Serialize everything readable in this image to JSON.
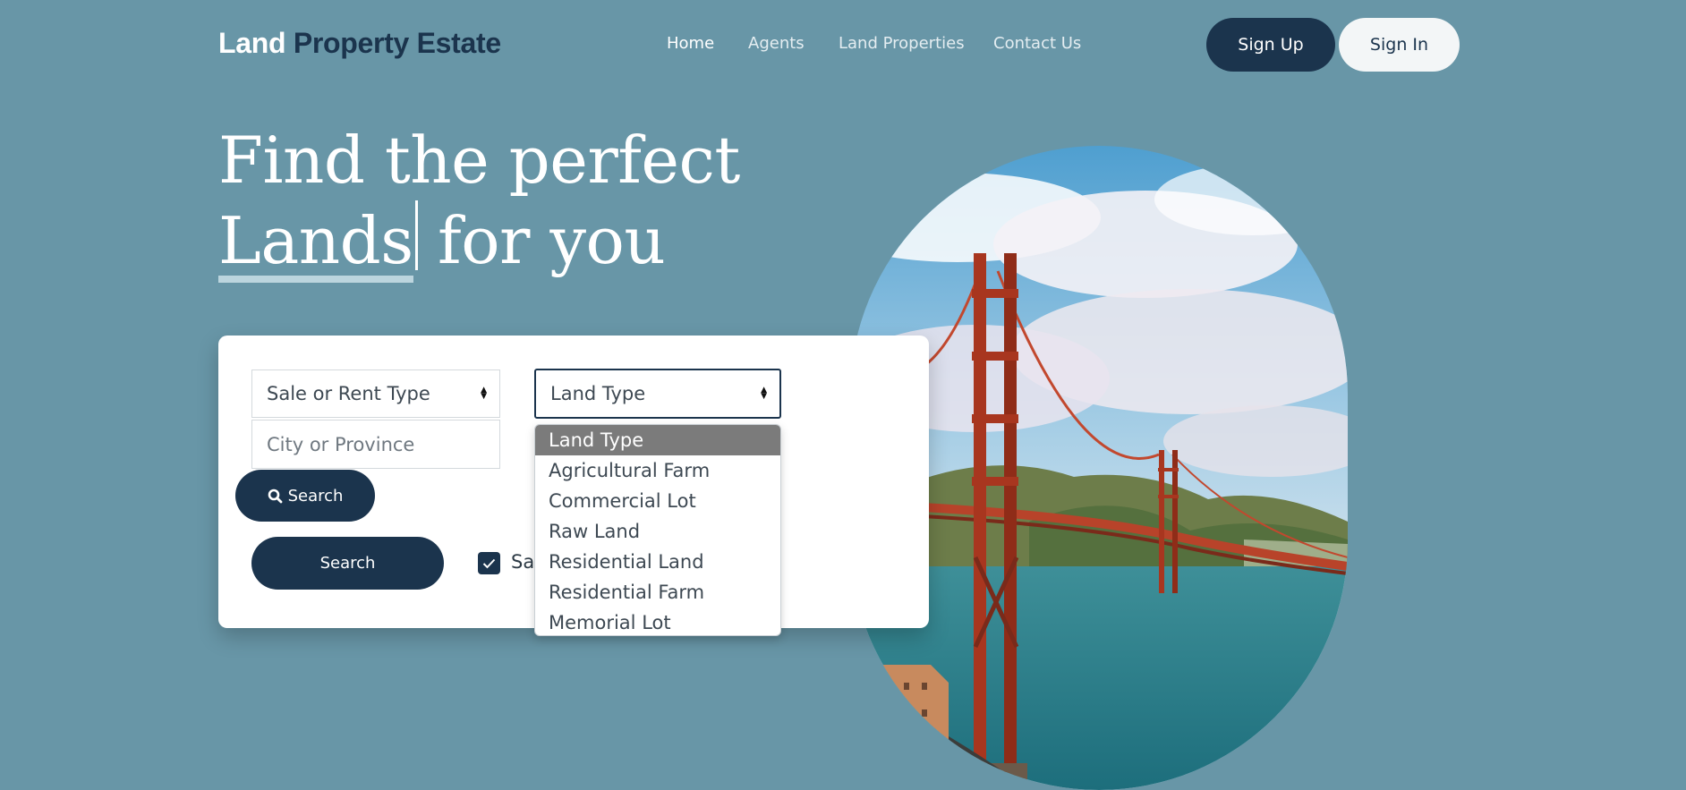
{
  "brand": {
    "part1": "Land",
    "part2": "Property Estate"
  },
  "nav": {
    "items": [
      "Home",
      "Agents",
      "Land Properties",
      "Contact Us"
    ],
    "active": "Home"
  },
  "auth": {
    "signup_label": "Sign Up",
    "signin_label": "Sign In"
  },
  "hero": {
    "line1": "Find the perfect",
    "highlight": "Lands",
    "line2_rest": " for you"
  },
  "search": {
    "sale_rent_select": "Sale or Rent Type",
    "land_type_select": "Land Type",
    "city_placeholder": "City or Province",
    "search_icon_button_label": "Search",
    "search_button_label": "Search",
    "save_checkbox_label": "Sav",
    "save_checked": true
  },
  "dropdown": {
    "options": [
      "Land Type",
      "Agricultural Farm",
      "Commercial Lot",
      "Raw Land",
      "Residential Land",
      "Residential Farm",
      "Memorial Lot"
    ],
    "selected": "Land Type"
  },
  "colors": {
    "background": "#6896a7",
    "primary": "#1b344d",
    "card": "#ffffff",
    "highlight_underline": "#bcd5de"
  },
  "image": {
    "subject": "Golden Gate Bridge over the bay"
  }
}
